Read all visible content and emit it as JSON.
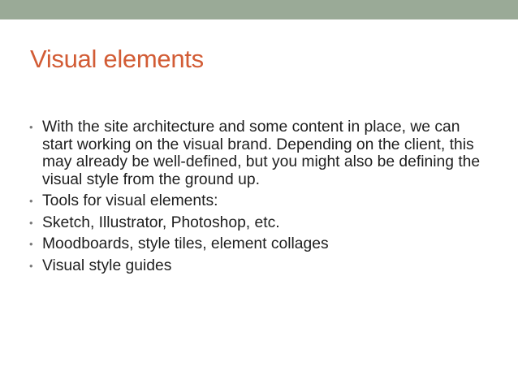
{
  "slide": {
    "title": "Visual elements",
    "bullet_glyph": "•",
    "bullets": [
      {
        "text": "With the site architecture and some content in place, we can start working on the visual brand. Depending on the client, this may already be well-defined, but you might also be defining the visual style from the ground up."
      },
      {
        "text": "Tools for visual elements:"
      },
      {
        "text": "Sketch, Illustrator, Photoshop, etc."
      },
      {
        "text": "Moodboards, style tiles, element collages"
      },
      {
        "text": "Visual style guides"
      }
    ]
  },
  "colors": {
    "top_band": "#9aaa97",
    "title": "#d25c35",
    "body_text": "#1e1e1e",
    "bullet": "#7a7a7a",
    "background": "#ffffff"
  }
}
